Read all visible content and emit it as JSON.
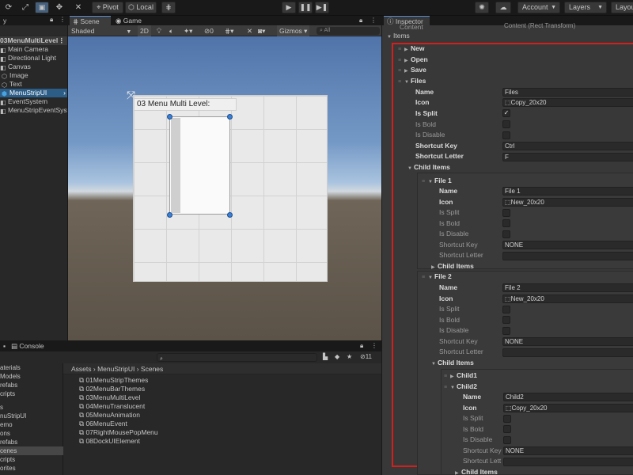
{
  "toolbar": {
    "pivot": "Pivot",
    "local": "Local",
    "account": "Account",
    "layers": "Layers",
    "layout": "Layou"
  },
  "hierarchy": {
    "tab": "y",
    "items": [
      "03MenuMultiLevel",
      "Main Camera",
      "Directional Light",
      "Canvas",
      "Image",
      "Text",
      "MenuStripUI",
      "EventSystem",
      "MenuStripEventSyste"
    ]
  },
  "scene": {
    "tab_scene": "Scene",
    "tab_game": "Game",
    "shading": "Shaded",
    "mode_2d": "2D",
    "layer_count": "0",
    "gizmos": "Gizmos",
    "search_placeholder": "All",
    "canvas_label": "03 Menu Multi Level:"
  },
  "bottom": {
    "tab_console": "Console",
    "count": "11",
    "folders": [
      "aterials",
      "Models",
      "refabs",
      "cripts",
      "s",
      "nuStripUI",
      "emo",
      "ons",
      "refabs",
      "cenes",
      "cripts",
      "orites",
      "mes"
    ],
    "breadcrumb": [
      "Assets",
      "MenuStripUI",
      "Scenes"
    ],
    "scenes": [
      "01MenuStripThemes",
      "02MenuBarThemes",
      "03MenuMultiLevel",
      "04MenuTranslucent",
      "05MenuAnimation",
      "06MenuEvent",
      "07RightMousePopMenu",
      "08DockUIElement"
    ]
  },
  "inspector": {
    "tab": "Inspector",
    "content_row": "Content (Rect Transform)",
    "items_label": "Items",
    "new_label": "New",
    "open_label": "Open",
    "save_label": "Save",
    "files_label": "Files",
    "labels": {
      "name": "Name",
      "icon": "Icon",
      "is_split": "Is Split",
      "is_bold": "Is Bold",
      "is_disable": "Is Disable",
      "shortcut_key": "Shortcut Key",
      "shortcut_letter": "Shortcut Letter",
      "child_items": "Child Items",
      "shortcut_key_trunc": "Shortcut Key",
      "shortcut_lett_trunc": "Shortcut Lett"
    },
    "files": {
      "name": "Files",
      "icon": "Copy_20x20",
      "is_split": true,
      "shortcut_key": "Ctrl",
      "shortcut_letter": "F"
    },
    "file1": {
      "label": "File 1",
      "name": "File 1",
      "icon": "New_20x20",
      "shortcut_key": "NONE",
      "shortcut_letter": ""
    },
    "file2": {
      "label": "File 2",
      "name": "File 2",
      "icon": "New_20x20",
      "shortcut_key": "NONE",
      "shortcut_letter": ""
    },
    "child1_label": "Child1",
    "child2": {
      "label": "Child2",
      "name": "Child2",
      "icon": "Copy_20x20",
      "shortcut_key": "NONE"
    }
  },
  "colors": {
    "highlight": "#d41f1f",
    "selection": "#2c5d87",
    "handle": "#3a7fd5"
  }
}
